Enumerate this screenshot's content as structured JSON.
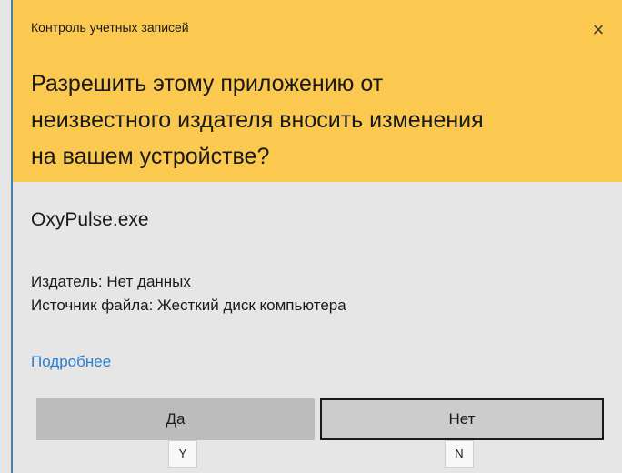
{
  "dialog": {
    "title": "Контроль учетных записей",
    "close_glyph": "×",
    "question_lines": [
      "Разрешить этому приложению от",
      "неизвестного издателя вносить изменения",
      "на вашем устройстве?"
    ],
    "app_name": "OxyPulse.exe",
    "publisher": "Издатель: Нет данных",
    "source": "Источник файла: Жесткий диск компьютера",
    "more_link": "Подробнее",
    "buttons": {
      "yes": "Да",
      "no": "Нет"
    },
    "key_hints": {
      "yes": "Y",
      "no": "N"
    }
  },
  "colors": {
    "header_bg": "#fbc950",
    "body_bg": "#e6e6e6",
    "link": "#2a7fd0",
    "edge": "#4a7fa8"
  },
  "icons": {
    "close": "close-icon"
  }
}
